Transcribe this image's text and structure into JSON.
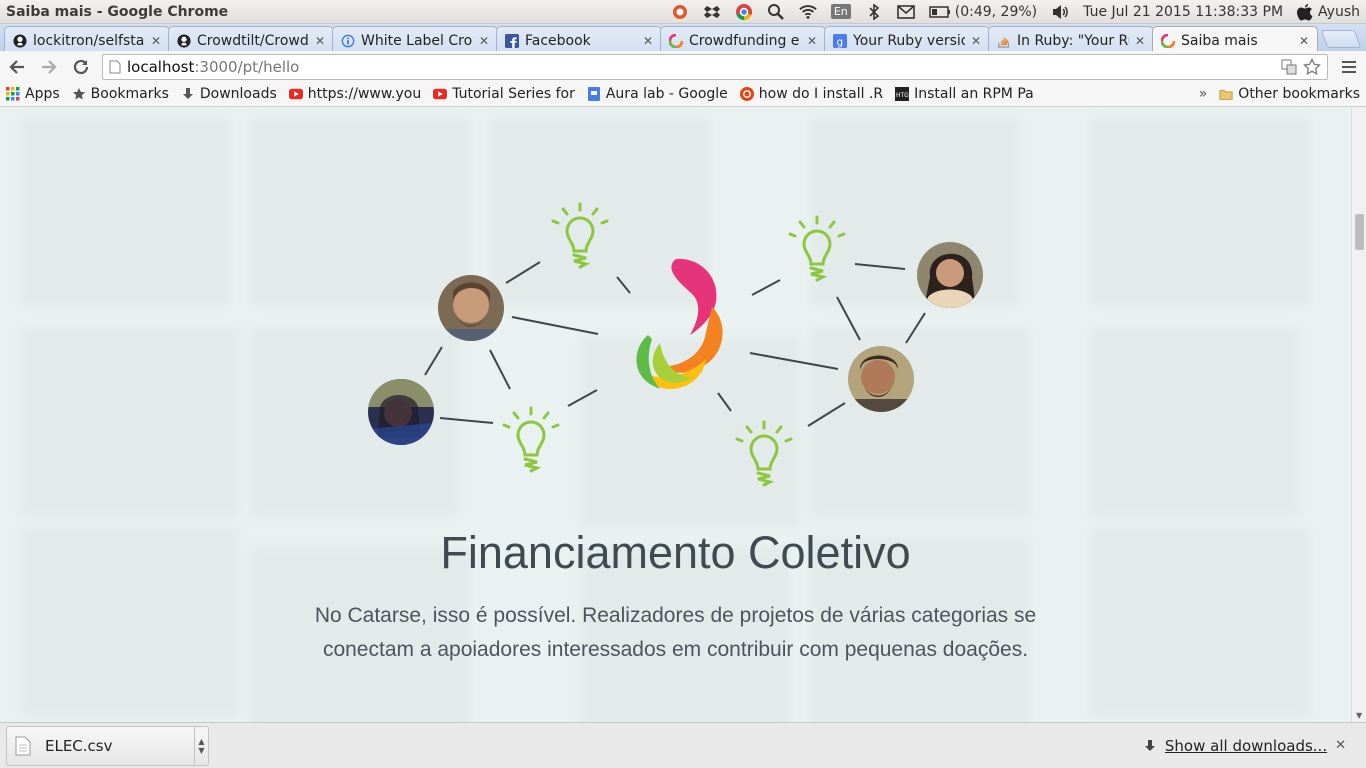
{
  "os": {
    "window_title": "Saiba mais - Google Chrome",
    "battery": "(0:49, 29%)",
    "datetime": "Tue Jul 21 2015 11:38:33 PM",
    "user": "Ayush",
    "input_lang": "En"
  },
  "tabs": [
    {
      "label": "lockitron/selfsta",
      "icon": "github-icon",
      "active": false
    },
    {
      "label": "Crowdtilt/Crowd",
      "icon": "github-icon",
      "active": false
    },
    {
      "label": "White Label Crow",
      "icon": "info-icon",
      "active": false
    },
    {
      "label": "Facebook",
      "icon": "facebook-icon",
      "active": false
    },
    {
      "label": "Crowdfunding e",
      "icon": "catarse-icon",
      "active": false
    },
    {
      "label": "Your Ruby versio",
      "icon": "google-icon",
      "active": false
    },
    {
      "label": "In Ruby: \"Your Ru",
      "icon": "stackoverflow-icon",
      "active": false
    },
    {
      "label": "Saiba mais",
      "icon": "catarse-icon",
      "active": true
    }
  ],
  "toolbar": {
    "url_host": "localhost",
    "url_path": ":3000/pt/hello"
  },
  "bookmarks": {
    "items": [
      {
        "label": "Apps",
        "icon": "apps-grid-icon"
      },
      {
        "label": "Bookmarks",
        "icon": "star-icon"
      },
      {
        "label": "Downloads",
        "icon": "download-arrow-icon"
      },
      {
        "label": "https://www.you",
        "icon": "youtube-icon"
      },
      {
        "label": "Tutorial Series for",
        "icon": "youtube-icon"
      },
      {
        "label": "Aura lab - Google",
        "icon": "google-doc-icon"
      },
      {
        "label": "how do I install .R",
        "icon": "ubuntu-icon"
      },
      {
        "label": "Install an RPM Pa",
        "icon": "htg-icon"
      }
    ],
    "overflow": "»",
    "other": "Other bookmarks"
  },
  "content": {
    "headline": "Financiamento Coletivo",
    "lede": "No Catarse, isso é possível. Realizadores de projetos de várias categorias se conectam a apoiadores interessados em contribuir com pequenas doações."
  },
  "downloads": {
    "file": "ELEC.csv",
    "show_all": "Show all downloads..."
  },
  "colors": {
    "headline": "#3f4a52",
    "bulb": "#8dc63f",
    "logo_pink": "#e6347a",
    "logo_orange": "#f58220",
    "logo_yellow": "#fdc010",
    "logo_green": "#5dbb46"
  }
}
